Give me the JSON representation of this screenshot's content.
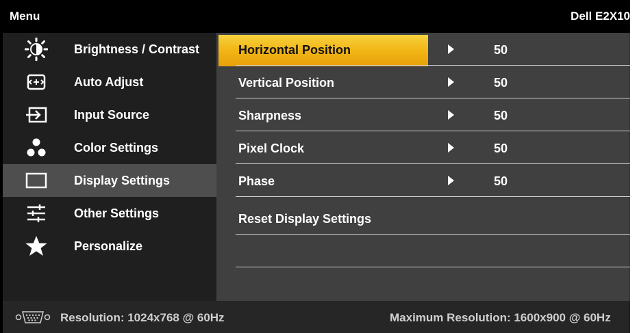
{
  "header": {
    "title": "Menu",
    "model": "Dell E2X10"
  },
  "menu": {
    "items": [
      {
        "label": "Brightness / Contrast",
        "icon": "brightness-icon"
      },
      {
        "label": "Auto Adjust",
        "icon": "auto-adjust-icon"
      },
      {
        "label": "Input Source",
        "icon": "input-source-icon"
      },
      {
        "label": "Color Settings",
        "icon": "color-settings-icon"
      },
      {
        "label": "Display Settings",
        "icon": "display-settings-icon",
        "selected": true
      },
      {
        "label": "Other Settings",
        "icon": "other-settings-icon"
      },
      {
        "label": "Personalize",
        "icon": "star-icon"
      }
    ]
  },
  "submenu": {
    "rows": [
      {
        "label": "Horizontal Position",
        "value": "50",
        "selected": true
      },
      {
        "label": "Vertical Position",
        "value": "50"
      },
      {
        "label": "Sharpness",
        "value": "50"
      },
      {
        "label": "Pixel Clock",
        "value": "50"
      },
      {
        "label": "Phase",
        "value": "50"
      },
      {
        "label": "Reset Display Settings",
        "value": ""
      },
      {
        "label": "",
        "value": ""
      }
    ]
  },
  "footer": {
    "resolution": "Resolution: 1024x768 @ 60Hz",
    "max_resolution": "Maximum Resolution: 1600x900 @ 60Hz",
    "connector_icon": "vga-connector-icon"
  },
  "colors": {
    "highlight_top": "#f6d23f",
    "highlight_bottom": "#e7a10a",
    "left_bg": "#1f1f1f",
    "right_bg": "#404040",
    "selected_left_bg": "#4e4e4e"
  }
}
